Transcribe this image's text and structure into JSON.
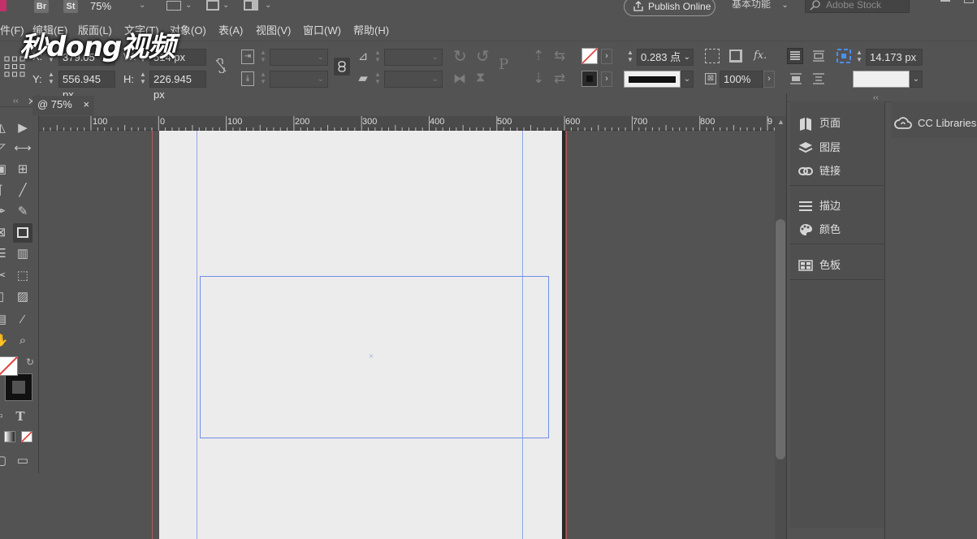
{
  "app_bar": {
    "bridge_label": "Br",
    "stock_label": "St",
    "zoom": "75%",
    "publish_label": "Publish Online",
    "workspace": "基本功能",
    "stock_search_placeholder": "Adobe Stock"
  },
  "menu": [
    "件(F)",
    "编辑(E)",
    "版面(L)",
    "文字(T)",
    "对象(O)",
    "表(A)",
    "视图(V)",
    "窗口(W)",
    "帮助(H)"
  ],
  "control": {
    "x_label": "X:",
    "x_value": "379.05",
    "w_label": "W:",
    "w_value": "514 px",
    "y_label": "Y:",
    "y_value": "556.945 px",
    "h_label": "H:",
    "h_value": "226.945 px",
    "stroke_weight": "0.283 点",
    "opacity": "100%",
    "spacing": "14.173 px",
    "effects_label": "fx."
  },
  "document_tab": {
    "title": "@ 75%",
    "close": "×"
  },
  "ruler": {
    "labels": [
      "100",
      "0",
      "100",
      "200",
      "300",
      "400",
      "500",
      "600",
      "700",
      "800",
      "9"
    ]
  },
  "panels": {
    "items": [
      "页面",
      "图层",
      "链接",
      "描边",
      "颜色",
      "色板"
    ],
    "libraries": "CC Libraries"
  },
  "watermark": "秒dong视频",
  "colors": {
    "ui_bg": "#535353",
    "page_bg": "#ececec",
    "guide": "#7a96e6",
    "bleed": "#d45b5b",
    "accent": "#5b8fe0"
  }
}
